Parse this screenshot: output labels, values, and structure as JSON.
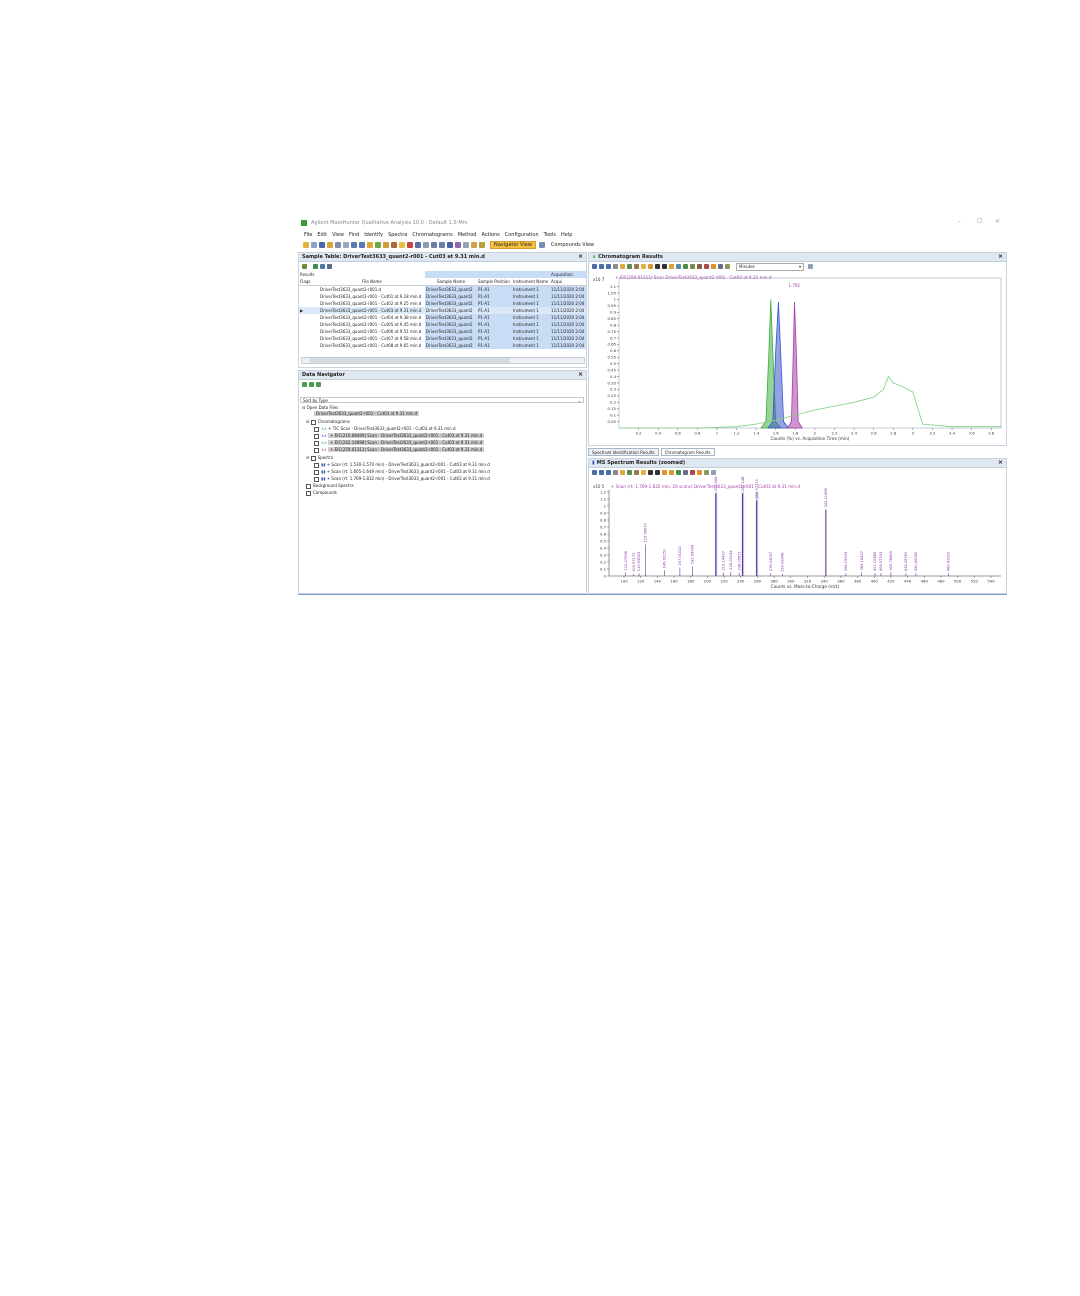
{
  "window": {
    "title": "Agilent MassHunter Qualitative Analysis 10.0 - Default 1.0-Mm",
    "controls": [
      "–",
      "☐",
      "✕"
    ]
  },
  "menu": [
    "File",
    "Edit",
    "View",
    "Find",
    "Identify",
    "Spectra",
    "Chromatograms",
    "Method",
    "Actions",
    "Configuration",
    "Tools",
    "Help"
  ],
  "toolbar": {
    "navigator_view": "Navigator View",
    "compounds_view": "Compounds View"
  },
  "sample_table": {
    "title": "Sample Table: DriverTest3633_quant2-r001 - Cut03 at 9.31 min.d",
    "group_results": "Results",
    "group_acquisition": "Acquisition",
    "columns": [
      "Flags",
      "File Name",
      "Sample Name",
      "Sample Position",
      "Instrument Name",
      "Acqui"
    ],
    "rows": [
      [
        "",
        "DriverTest3633_quant2-r001.d",
        "DriverTest3633_quant2",
        "P1-A1",
        "Instrument 1",
        "11/11/2020 2:04"
      ],
      [
        "",
        "DriverTest3633_quant2-r001 - Cut01 at 9.18 min.d",
        "DriverTest3633_quant2",
        "P1-A1",
        "Instrument 1",
        "11/11/2020 2:04"
      ],
      [
        "",
        "DriverTest3633_quant2-r001 - Cut02 at 9.25 min.d",
        "DriverTest3633_quant2",
        "P1-A1",
        "Instrument 1",
        "11/11/2020 2:04"
      ],
      [
        "▶",
        "DriverTest3633_quant2-r001 - Cut03 at 9.31 min.d",
        "DriverTest3633_quant2",
        "P1-A1",
        "Instrument 1",
        "11/11/2020 2:04"
      ],
      [
        "",
        "DriverTest3633_quant2-r001 - Cut04 at 9.38 min.d",
        "DriverTest3633_quant2",
        "P1-A1",
        "Instrument 1",
        "11/11/2020 2:04"
      ],
      [
        "",
        "DriverTest3633_quant2-r001 - Cut05 at 9.45 min.d",
        "DriverTest3633_quant2",
        "P1-A1",
        "Instrument 1",
        "11/11/2020 2:04"
      ],
      [
        "",
        "DriverTest3633_quant2-r001 - Cut06 at 9.51 min.d",
        "DriverTest3633_quant2",
        "P1-A1",
        "Instrument 1",
        "11/11/2020 2:04"
      ],
      [
        "",
        "DriverTest3633_quant2-r001 - Cut07 at 9.58 min.d",
        "DriverTest3633_quant2",
        "P1-A1",
        "Instrument 1",
        "11/11/2020 2:04"
      ],
      [
        "",
        "DriverTest3633_quant2-r001 - Cut08 at 9.65 min.d",
        "DriverTest3633_quant2",
        "P1-A1",
        "Instrument 1",
        "11/11/2020 2:04"
      ]
    ]
  },
  "navigator": {
    "title": "Data Navigator",
    "sort": "Sort by Type",
    "open_files": "Open Data Files",
    "file": "DriverTest3633_quant2-r001 - Cut03 at 9.31 min.d",
    "chromatograms_label": "Chromatograms",
    "chromatograms": [
      "+ TIC Scan - DriverTest3633_quant2-r001 - Cut03 at 9.31 min.d",
      "+ EIC(210.08469) Scan - DriverTest3633_quant2-r001 - Cut03 at 9.31 min.d",
      "+ EIC(242.14898) Scan - DriverTest3633_quant2-r001 - Cut03 at 9.31 min.d",
      "+ EIC(259.01311) Scan - DriverTest3633_quant2-r001 - Cut03 at 9.31 min.d"
    ],
    "spectra_label": "Spectra",
    "spectra": [
      "+ Scan (rt: 1.530-1.570 min) - DriverTest3633_quant2-r001 - Cut03 at 9.31 min.d",
      "+ Scan (rt: 1.605-1.649 min) - DriverTest3633_quant2-r001 - Cut03 at 9.31 min.d",
      "+ Scan (rt: 1.769-1.832 min) - DriverTest3633_quant2-r001 - Cut03 at 9.31 min.d"
    ],
    "background": "Background Spectra",
    "compounds": "Compounds"
  },
  "chrom": {
    "title": "Chromatogram Results",
    "units": "Minutes",
    "trace_label": "+ EIC(259.01311) Scan DriverTest3633_quant2-r001 - Cut03 at 9.31 min.d",
    "exp": "x10 7",
    "peak_label": "1.792",
    "xlabel": "Counts (%) vs. Acquisition Time (min)",
    "tabs": [
      "Spectrum Identification Results",
      "Chromatogram Results"
    ]
  },
  "ms": {
    "title": "MS Spectrum Results (zoomed)",
    "trace_label": "+ Scan (rt: 1.769-1.832 min, 20 scans) DriverTest3633_quant2-r001 - Cut03 at 9.31 min.d",
    "exp": "x10 5",
    "xlabel": "Counts vs. Mass-to-Charge (m/z)"
  },
  "chart_data": [
    {
      "type": "line",
      "title": "+ EIC(259.01311) Scan DriverTest3633_quant2-r001 - Cut03 at 9.31 min.d",
      "xlabel": "Counts (%) vs. Acquisition Time (min)",
      "ylabel": "x10 7",
      "xlim": [
        0,
        3.9
      ],
      "ylim": [
        0,
        1.12
      ],
      "x_ticks": [
        0.2,
        0.4,
        0.6,
        0.8,
        1,
        1.2,
        1.4,
        1.6,
        1.8,
        2,
        2.2,
        2.4,
        2.6,
        2.8,
        3,
        3.2,
        3.4,
        3.6,
        3.8
      ],
      "y_ticks": [
        0.05,
        0.1,
        0.15,
        0.2,
        0.25,
        0.3,
        0.35,
        0.4,
        0.45,
        0.5,
        0.55,
        0.6,
        0.65,
        0.7,
        0.75,
        0.8,
        0.85,
        0.9,
        0.95,
        1,
        1.05,
        1.1
      ],
      "annotations": [
        {
          "x": 1.792,
          "text": "1.792"
        }
      ],
      "series": [
        {
          "color": "#3fae3f",
          "x": [
            1.45,
            1.5,
            1.53,
            1.55,
            1.57,
            1.6,
            1.65
          ],
          "y": [
            0,
            0.05,
            0.6,
            1.0,
            0.6,
            0.05,
            0
          ]
        },
        {
          "color": "#3a55c9",
          "x": [
            1.52,
            1.57,
            1.6,
            1.627,
            1.65,
            1.68,
            1.73
          ],
          "y": [
            0,
            0.05,
            0.6,
            0.98,
            0.6,
            0.05,
            0
          ]
        },
        {
          "color": "#a63da6",
          "x": [
            1.72,
            1.76,
            1.78,
            1.792,
            1.81,
            1.83,
            1.87
          ],
          "y": [
            0,
            0.05,
            0.6,
            0.98,
            0.6,
            0.05,
            0
          ]
        },
        {
          "color": "#7fcf7f",
          "x": [
            0,
            0.8,
            1.0,
            1.2,
            1.4,
            1.6,
            1.8,
            2.0,
            2.2,
            2.4,
            2.6,
            2.7,
            2.75,
            2.8,
            2.9,
            3.0,
            3.1,
            3.4,
            3.9
          ],
          "y": [
            0,
            0,
            0.005,
            0.01,
            0.03,
            0.06,
            0.1,
            0.14,
            0.17,
            0.2,
            0.24,
            0.3,
            0.4,
            0.35,
            0.32,
            0.28,
            0.03,
            0.01,
            0.01
          ]
        }
      ]
    },
    {
      "type": "bar",
      "title": "+ Scan (rt: 1.769-1.832 min, 20 scans) DriverTest3633_quant2-r001 - Cut03 at 9.31 min.d",
      "xlabel": "Counts vs. Mass-to-Charge (m/z)",
      "ylabel": "x10 5",
      "xlim": [
        82,
        552
      ],
      "ylim": [
        0,
        1.2
      ],
      "x_ticks": [
        100,
        120,
        140,
        160,
        180,
        200,
        220,
        240,
        260,
        280,
        300,
        320,
        340,
        360,
        380,
        400,
        420,
        440,
        460,
        480,
        500,
        520,
        540
      ],
      "y_ticks": [
        0,
        0.1,
        0.2,
        0.3,
        0.4,
        0.5,
        0.6,
        0.7,
        0.8,
        0.9,
        1,
        1.1,
        1.2
      ],
      "highlight_ranges": [
        [
          209,
          212
        ],
        [
          241,
          244
        ],
        [
          258,
          261
        ]
      ],
      "peaks": [
        {
          "mz": 102.0,
          "y": 0.05,
          "label": "102.07068"
        },
        {
          "mz": 111.5,
          "y": 0.03,
          "label": "109.57173"
        },
        {
          "mz": 118.0,
          "y": 0.04,
          "label": "119.05625"
        },
        {
          "mz": 125.5,
          "y": 0.45,
          "label": "125.98673"
        },
        {
          "mz": 148.5,
          "y": 0.08,
          "label": "149.00151"
        },
        {
          "mz": 167.0,
          "y": 0.12,
          "label": "167.91022"
        },
        {
          "mz": 182.0,
          "y": 0.14,
          "label": "182.98954"
        },
        {
          "mz": 210.08,
          "y": 1.18,
          "label": "210.08469"
        },
        {
          "mz": 219.0,
          "y": 0.05,
          "label": "219.14437"
        },
        {
          "mz": 228.0,
          "y": 0.06,
          "label": "228.05144"
        },
        {
          "mz": 238.0,
          "y": 0.05,
          "label": "238.05621"
        },
        {
          "mz": 242.15,
          "y": 1.18,
          "label": "242.14898"
        },
        {
          "mz": 259.01,
          "y": 1.08,
          "label": "259.01311"
        },
        {
          "mz": 276.0,
          "y": 0.04,
          "label": "276.04057"
        },
        {
          "mz": 290.0,
          "y": 0.03,
          "label": "290.08948"
        },
        {
          "mz": 342.0,
          "y": 0.95,
          "label": "342.11485"
        },
        {
          "mz": 366.0,
          "y": 0.04,
          "label": "366.15305"
        },
        {
          "mz": 385.0,
          "y": 0.05,
          "label": "385.18437"
        },
        {
          "mz": 401.0,
          "y": 0.04,
          "label": "401.10485"
        },
        {
          "mz": 408.0,
          "y": 0.04,
          "label": "408.57253"
        },
        {
          "mz": 420.0,
          "y": 0.05,
          "label": "420.78469"
        },
        {
          "mz": 438.0,
          "y": 0.04,
          "label": "438.28780"
        },
        {
          "mz": 450.0,
          "y": 0.04,
          "label": "450.46380"
        },
        {
          "mz": 489.0,
          "y": 0.04,
          "label": "489.42620"
        }
      ]
    }
  ]
}
